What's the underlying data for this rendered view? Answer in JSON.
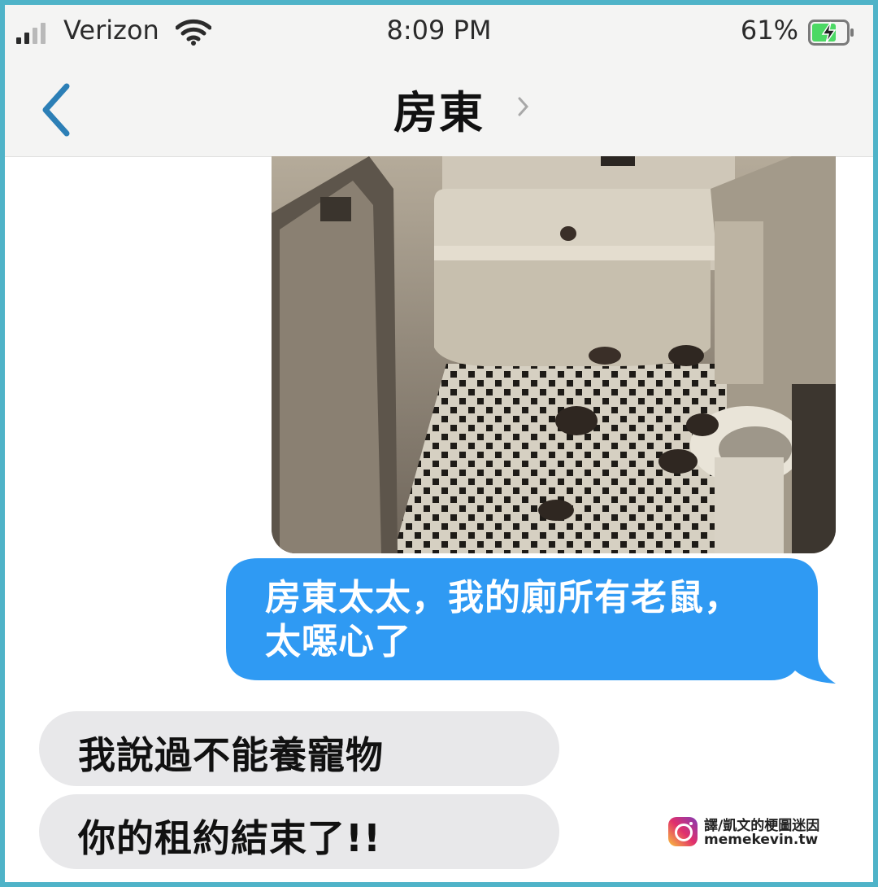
{
  "status_bar": {
    "carrier": "Verizon",
    "time": "8:09 PM",
    "battery_percent": "61%",
    "signal_bars_on": 2,
    "signal_bars_total": 4,
    "battery_charging": true
  },
  "nav": {
    "back_icon": "chevron-left-icon",
    "contact_name": "房東",
    "detail_icon": "chevron-right-icon"
  },
  "messages": [
    {
      "type": "image",
      "direction": "outgoing",
      "description_icon": "photo-attachment"
    },
    {
      "type": "text",
      "direction": "outgoing",
      "lines": [
        "房東太太，我的廁所有老鼠，",
        "太噁心了"
      ]
    },
    {
      "type": "text",
      "direction": "incoming",
      "text": "我說過不能養寵物"
    },
    {
      "type": "text",
      "direction": "incoming",
      "text": "你的租約結束了!!"
    }
  ],
  "watermark": {
    "icon": "instagram-icon",
    "line1": "譯/凱文的梗圖迷因",
    "line2": "memekevin.tw"
  },
  "colors": {
    "frame": "#4fb3c8",
    "sent_bubble": "#2f9af3",
    "received_bubble": "#e8e8ea",
    "back_chevron": "#2c7fb6"
  }
}
